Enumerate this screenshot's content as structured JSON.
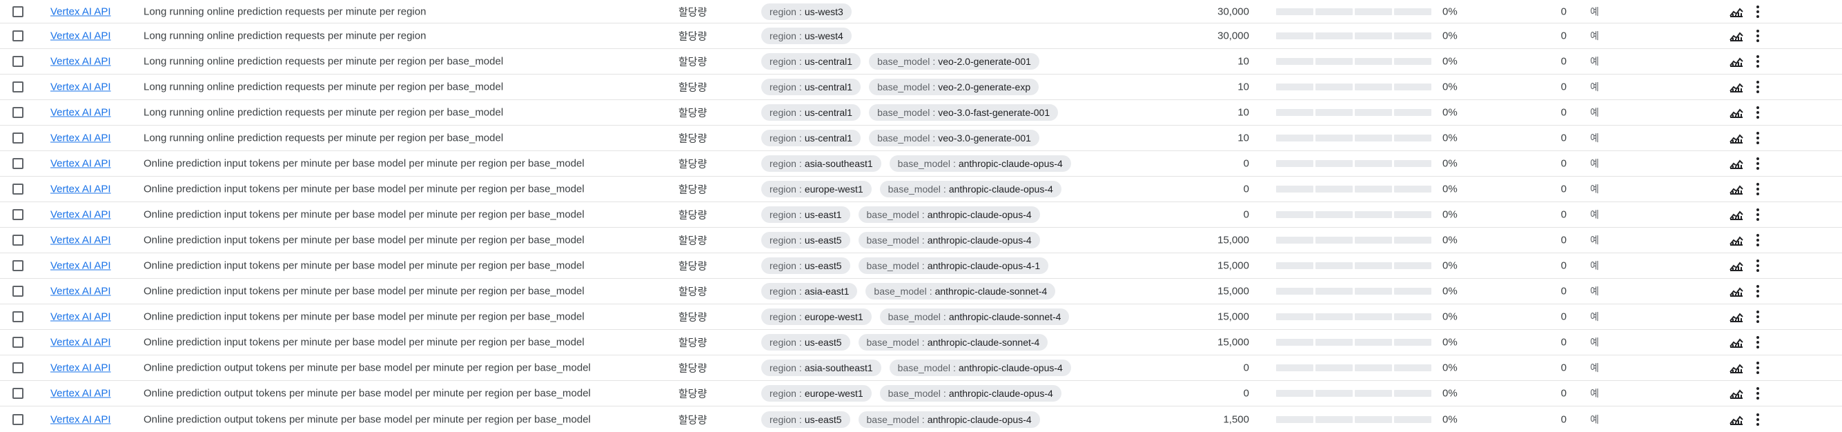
{
  "table": {
    "rows": [
      {
        "service": "Vertex AI API",
        "name": "Long running online prediction requests per minute per region",
        "type": "할당량",
        "dims": [
          {
            "k": "region",
            "v": "us-west3"
          }
        ],
        "value": "30,000",
        "percent": "0%",
        "usage": "0",
        "adjustable": "예"
      },
      {
        "service": "Vertex AI API",
        "name": "Long running online prediction requests per minute per region",
        "type": "할당량",
        "dims": [
          {
            "k": "region",
            "v": "us-west4"
          }
        ],
        "value": "30,000",
        "percent": "0%",
        "usage": "0",
        "adjustable": "예"
      },
      {
        "service": "Vertex AI API",
        "name": "Long running online prediction requests per minute per region per base_model",
        "type": "할당량",
        "dims": [
          {
            "k": "region",
            "v": "us-central1"
          },
          {
            "k": "base_model",
            "v": "veo-2.0-generate-001"
          }
        ],
        "value": "10",
        "percent": "0%",
        "usage": "0",
        "adjustable": "예"
      },
      {
        "service": "Vertex AI API",
        "name": "Long running online prediction requests per minute per region per base_model",
        "type": "할당량",
        "dims": [
          {
            "k": "region",
            "v": "us-central1"
          },
          {
            "k": "base_model",
            "v": "veo-2.0-generate-exp"
          }
        ],
        "value": "10",
        "percent": "0%",
        "usage": "0",
        "adjustable": "예"
      },
      {
        "service": "Vertex AI API",
        "name": "Long running online prediction requests per minute per region per base_model",
        "type": "할당량",
        "dims": [
          {
            "k": "region",
            "v": "us-central1"
          },
          {
            "k": "base_model",
            "v": "veo-3.0-fast-generate-001"
          }
        ],
        "value": "10",
        "percent": "0%",
        "usage": "0",
        "adjustable": "예"
      },
      {
        "service": "Vertex AI API",
        "name": "Long running online prediction requests per minute per region per base_model",
        "type": "할당량",
        "dims": [
          {
            "k": "region",
            "v": "us-central1"
          },
          {
            "k": "base_model",
            "v": "veo-3.0-generate-001"
          }
        ],
        "value": "10",
        "percent": "0%",
        "usage": "0",
        "adjustable": "예"
      },
      {
        "service": "Vertex AI API",
        "name": "Online prediction input tokens per minute per base model per minute per region per base_model",
        "type": "할당량",
        "dims": [
          {
            "k": "region",
            "v": "asia-southeast1"
          },
          {
            "k": "base_model",
            "v": "anthropic-claude-opus-4"
          }
        ],
        "value": "0",
        "percent": "0%",
        "usage": "0",
        "adjustable": "예"
      },
      {
        "service": "Vertex AI API",
        "name": "Online prediction input tokens per minute per base model per minute per region per base_model",
        "type": "할당량",
        "dims": [
          {
            "k": "region",
            "v": "europe-west1"
          },
          {
            "k": "base_model",
            "v": "anthropic-claude-opus-4"
          }
        ],
        "value": "0",
        "percent": "0%",
        "usage": "0",
        "adjustable": "예"
      },
      {
        "service": "Vertex AI API",
        "name": "Online prediction input tokens per minute per base model per minute per region per base_model",
        "type": "할당량",
        "dims": [
          {
            "k": "region",
            "v": "us-east1"
          },
          {
            "k": "base_model",
            "v": "anthropic-claude-opus-4"
          }
        ],
        "value": "0",
        "percent": "0%",
        "usage": "0",
        "adjustable": "예"
      },
      {
        "service": "Vertex AI API",
        "name": "Online prediction input tokens per minute per base model per minute per region per base_model",
        "type": "할당량",
        "dims": [
          {
            "k": "region",
            "v": "us-east5"
          },
          {
            "k": "base_model",
            "v": "anthropic-claude-opus-4"
          }
        ],
        "value": "15,000",
        "percent": "0%",
        "usage": "0",
        "adjustable": "예"
      },
      {
        "service": "Vertex AI API",
        "name": "Online prediction input tokens per minute per base model per minute per region per base_model",
        "type": "할당량",
        "dims": [
          {
            "k": "region",
            "v": "us-east5"
          },
          {
            "k": "base_model",
            "v": "anthropic-claude-opus-4-1"
          }
        ],
        "value": "15,000",
        "percent": "0%",
        "usage": "0",
        "adjustable": "예"
      },
      {
        "service": "Vertex AI API",
        "name": "Online prediction input tokens per minute per base model per minute per region per base_model",
        "type": "할당량",
        "dims": [
          {
            "k": "region",
            "v": "asia-east1"
          },
          {
            "k": "base_model",
            "v": "anthropic-claude-sonnet-4"
          }
        ],
        "value": "15,000",
        "percent": "0%",
        "usage": "0",
        "adjustable": "예"
      },
      {
        "service": "Vertex AI API",
        "name": "Online prediction input tokens per minute per base model per minute per region per base_model",
        "type": "할당량",
        "dims": [
          {
            "k": "region",
            "v": "europe-west1"
          },
          {
            "k": "base_model",
            "v": "anthropic-claude-sonnet-4"
          }
        ],
        "value": "15,000",
        "percent": "0%",
        "usage": "0",
        "adjustable": "예"
      },
      {
        "service": "Vertex AI API",
        "name": "Online prediction input tokens per minute per base model per minute per region per base_model",
        "type": "할당량",
        "dims": [
          {
            "k": "region",
            "v": "us-east5"
          },
          {
            "k": "base_model",
            "v": "anthropic-claude-sonnet-4"
          }
        ],
        "value": "15,000",
        "percent": "0%",
        "usage": "0",
        "adjustable": "예"
      },
      {
        "service": "Vertex AI API",
        "name": "Online prediction output tokens per minute per base model per minute per region per base_model",
        "type": "할당량",
        "dims": [
          {
            "k": "region",
            "v": "asia-southeast1"
          },
          {
            "k": "base_model",
            "v": "anthropic-claude-opus-4"
          }
        ],
        "value": "0",
        "percent": "0%",
        "usage": "0",
        "adjustable": "예"
      },
      {
        "service": "Vertex AI API",
        "name": "Online prediction output tokens per minute per base model per minute per region per base_model",
        "type": "할당량",
        "dims": [
          {
            "k": "region",
            "v": "europe-west1"
          },
          {
            "k": "base_model",
            "v": "anthropic-claude-opus-4"
          }
        ],
        "value": "0",
        "percent": "0%",
        "usage": "0",
        "adjustable": "예"
      },
      {
        "service": "Vertex AI API",
        "name": "Online prediction output tokens per minute per base model per minute per region per base_model",
        "type": "할당량",
        "dims": [
          {
            "k": "region",
            "v": "us-east5"
          },
          {
            "k": "base_model",
            "v": "anthropic-claude-opus-4"
          }
        ],
        "value": "1,500",
        "percent": "0%",
        "usage": "0",
        "adjustable": "예"
      }
    ],
    "usage_fraction": 0,
    "icons": {
      "chart": "chart-icon",
      "more": "more-vert-icon"
    },
    "colors": {
      "link": "#1a73e8",
      "chip_bg": "#e8eaed",
      "bar_bg": "#e8eaed",
      "divider": "#e3e3e3"
    }
  }
}
